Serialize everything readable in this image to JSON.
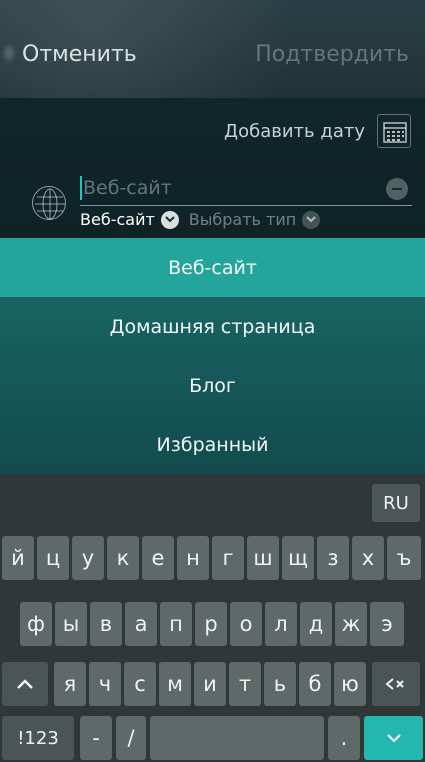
{
  "header": {
    "cancel_label": "Отменить",
    "confirm_label": "Подтвердить"
  },
  "form": {
    "add_date_label": "Добавить дату",
    "website_input": {
      "placeholder": "Веб-сайт",
      "value": ""
    },
    "selected_type_label": "Веб-сайт",
    "choose_type_label": "Выбрать тип"
  },
  "dropdown": {
    "items": [
      {
        "label": "Веб-сайт",
        "selected": true
      },
      {
        "label": "Домашняя страница",
        "selected": false
      },
      {
        "label": "Блог",
        "selected": false
      },
      {
        "label": "Избранный",
        "selected": false
      }
    ]
  },
  "keyboard": {
    "language_label": "RU",
    "row1": [
      "й",
      "ц",
      "у",
      "к",
      "е",
      "н",
      "г",
      "ш",
      "щ",
      "з",
      "х",
      "ъ"
    ],
    "row2": [
      "ф",
      "ы",
      "в",
      "а",
      "п",
      "р",
      "о",
      "л",
      "д",
      "ж",
      "э"
    ],
    "row3": [
      "я",
      "ч",
      "с",
      "м",
      "и",
      "т",
      "ь",
      "б",
      "ю"
    ],
    "shift_icon": "shift-arrow-icon",
    "backspace_icon": "backspace-icon",
    "symbols_label": "!123",
    "dash_label": "-",
    "slash_label": "/",
    "period_label": ".",
    "enter_icon": "chevron-down-icon"
  },
  "colors": {
    "accent": "#24a59b",
    "enter_key": "#23b7b0",
    "dropdown_bg": "#16595a",
    "keyboard_bg": "#2f3836",
    "key_bg": "#5f6967"
  }
}
